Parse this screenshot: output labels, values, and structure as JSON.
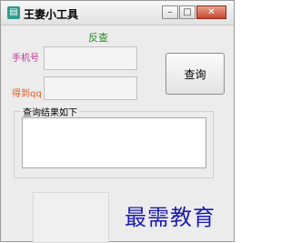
{
  "window": {
    "title": "王妻小工具",
    "minimize_symbol": "–",
    "maximize_symbol": "□",
    "close_symbol": "✕"
  },
  "form": {
    "reverse_link": "反查",
    "phone_label": "手机号",
    "phone_value": "",
    "qq_label": "得到qq",
    "qq_value": "",
    "query_button": "查询",
    "results_title": "查询结果如下",
    "results_value": ""
  },
  "watermark": "最需教育",
  "colors": {
    "label_magenta": "#c03090",
    "label_orange": "#e05a20",
    "link_green": "#2a8a2a",
    "watermark_blue": "#1d1db0"
  }
}
